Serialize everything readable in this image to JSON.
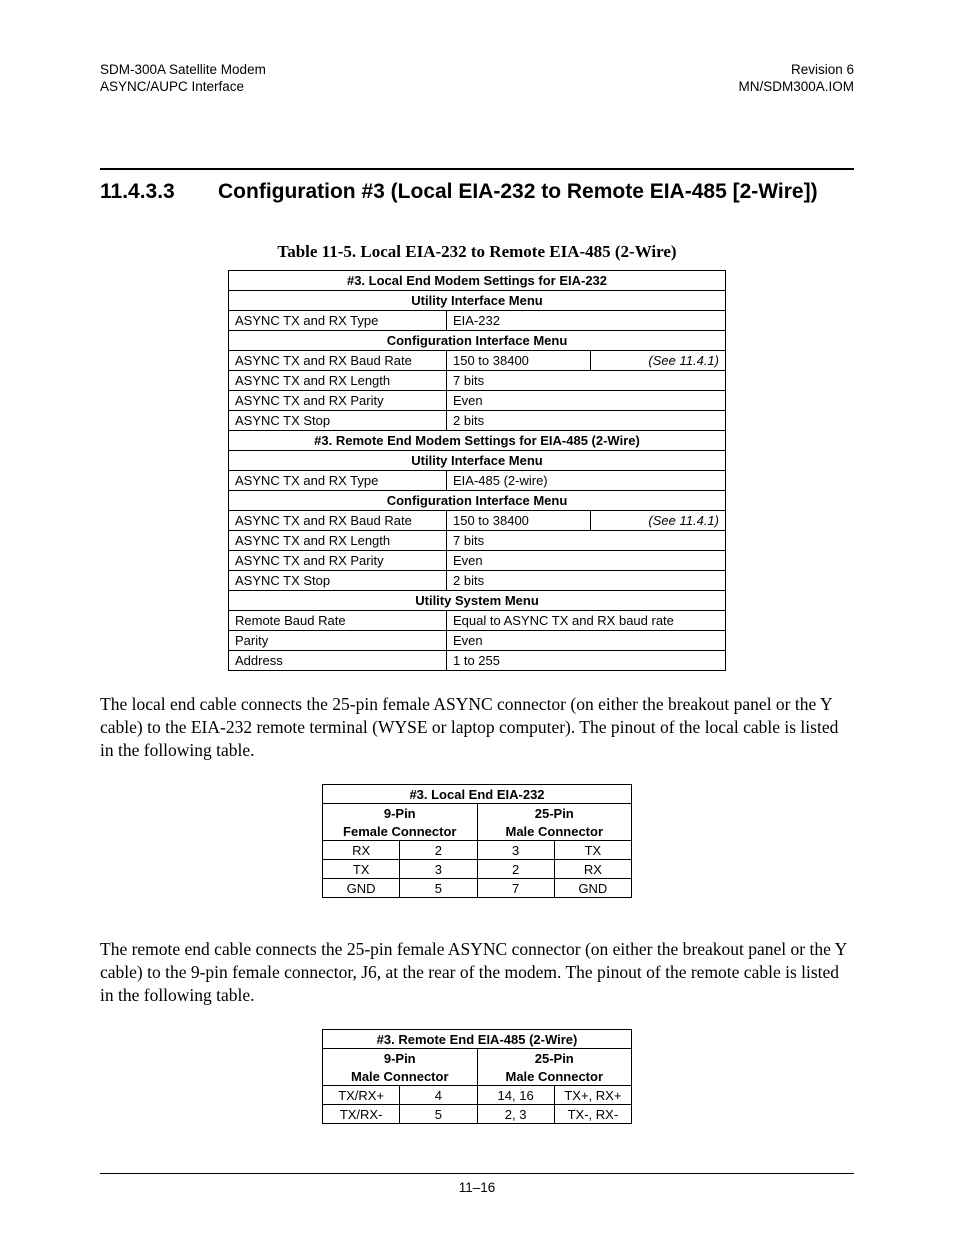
{
  "header": {
    "left1": "SDM-300A Satellite Modem",
    "left2": "ASYNC/AUPC Interface",
    "right1": "Revision 6",
    "right2": "MN/SDM300A.IOM"
  },
  "section": {
    "number": "11.4.3.3",
    "title": "Configuration #3 (Local EIA-232 to Remote EIA-485 [2-Wire])"
  },
  "table5": {
    "caption": "Table 11-5.  Local EIA-232 to Remote EIA-485 (2-Wire)",
    "r01": "#3. Local End Modem Settings for EIA-232",
    "r02": "Utility Interface Menu",
    "r03a": "ASYNC TX and RX Type",
    "r03b": "EIA-232",
    "r04": "Configuration Interface Menu",
    "r05a": "ASYNC TX and RX Baud Rate",
    "r05b": "150 to 38400",
    "r05c": "(See 11.4.1)",
    "r06a": "ASYNC TX and RX Length",
    "r06b": "7 bits",
    "r07a": "ASYNC TX and RX Parity",
    "r07b": "Even",
    "r08a": "ASYNC TX Stop",
    "r08b": "2 bits",
    "r09": "#3. Remote End Modem Settings for EIA-485 (2-Wire)",
    "r10": "Utility Interface Menu",
    "r11a": "ASYNC TX and RX Type",
    "r11b": "EIA-485 (2-wire)",
    "r12": "Configuration Interface Menu",
    "r13a": "ASYNC TX and RX Baud Rate",
    "r13b": "150 to 38400",
    "r13c": "(See 11.4.1)",
    "r14a": "ASYNC TX and RX Length",
    "r14b": "7 bits",
    "r15a": "ASYNC TX and RX Parity",
    "r15b": "Even",
    "r16a": "ASYNC TX Stop",
    "r16b": "2 bits",
    "r17": "Utility System Menu",
    "r18a": "Remote Baud Rate",
    "r18b": "Equal to ASYNC TX and RX baud rate",
    "r19a": "Parity",
    "r19b": "Even",
    "r20a": "Address",
    "r20b": "1 to 255"
  },
  "para1": "The local end cable connects the 25-pin female ASYNC connector (on either the breakout panel or the Y cable) to the EIA-232 remote terminal (WYSE or laptop computer). The pinout of the local cable is listed in the following table.",
  "pinout_local": {
    "title": "#3. Local End EIA-232",
    "h1a": "9-Pin",
    "h1b": "25-Pin",
    "h2a": "Female Connector",
    "h2b": "Male Connector",
    "rows": {
      "r1a": "RX",
      "r1b": "2",
      "r1c": "3",
      "r1d": "TX",
      "r2a": "TX",
      "r2b": "3",
      "r2c": "2",
      "r2d": "RX",
      "r3a": "GND",
      "r3b": "5",
      "r3c": "7",
      "r3d": "GND"
    }
  },
  "para2": "The remote end cable connects the 25-pin female ASYNC connector (on either the breakout panel or the Y cable) to the 9-pin female connector, J6, at the rear of the modem. The pinout of the remote cable is listed in the following table.",
  "pinout_remote": {
    "title": "#3. Remote End EIA-485 (2-Wire)",
    "h1a": "9-Pin",
    "h1b": "25-Pin",
    "h2a": "Male Connector",
    "h2b": "Male Connector",
    "rows": {
      "r1a": "TX/RX+",
      "r1b": "4",
      "r1c": "14, 16",
      "r1d": "TX+, RX+",
      "r2a": "TX/RX-",
      "r2b": "5",
      "r2c": "2, 3",
      "r2d": "TX-, RX-"
    }
  },
  "footer": {
    "page": "11–16"
  }
}
